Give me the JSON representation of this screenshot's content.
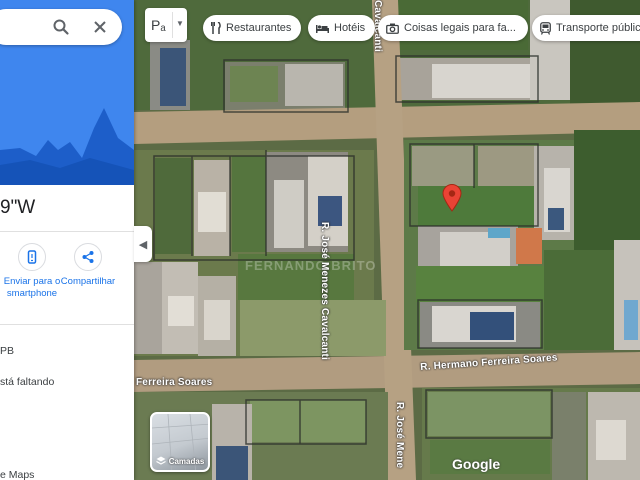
{
  "panel": {
    "coords_text": "9\"W",
    "actions": [
      {
        "label": "Enviar para o smartphone",
        "icon": "phone-icon"
      },
      {
        "label": "Compartilhar",
        "icon": "share-icon"
      }
    ],
    "info_lines": [
      "PB",
      "stá faltando",
      "e Maps"
    ]
  },
  "map_controls": {
    "mode_label": "Pₐ",
    "chips": [
      {
        "label": "Restaurantes",
        "icon": "restaurant-icon"
      },
      {
        "label": "Hotéis",
        "icon": "hotel-icon"
      },
      {
        "label": "Coisas legais para fa...",
        "icon": "camera-icon"
      },
      {
        "label": "Transporte públic",
        "icon": "transit-icon"
      }
    ],
    "layers_label": "Camadas"
  },
  "map": {
    "streets": {
      "jose_1": "R. José Menezes Cavalcanti",
      "jose_2": "R. José Mene",
      "hermano": "R. Hermano Ferreira Soares",
      "ferreira": "Ferreira Soares",
      "cavalcanti_top": "Cavalcanti"
    },
    "attribution": "Google",
    "watermark": "FERNANDO BRITO"
  },
  "colors": {
    "accent": "#1a73e8",
    "pin": "#ea4335",
    "hero": "#3f86ee"
  }
}
